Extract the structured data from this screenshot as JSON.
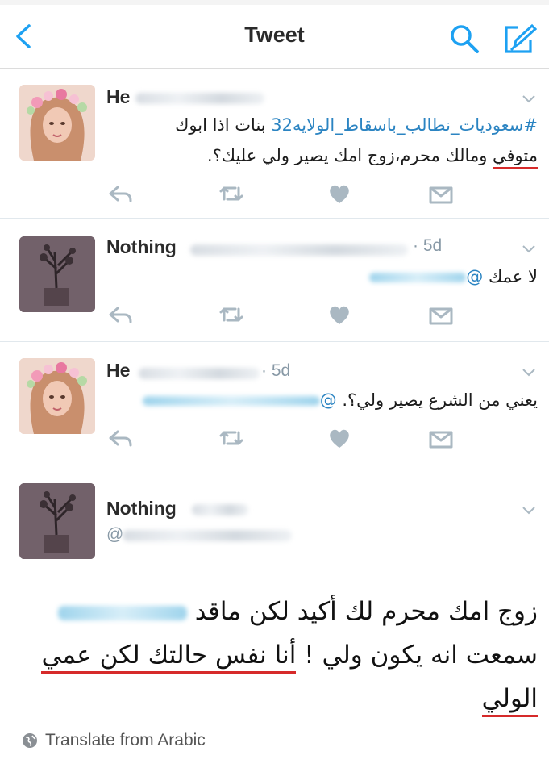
{
  "header": {
    "title": "Tweet"
  },
  "tweets": [
    {
      "name": "He",
      "hashtag": "#سعوديات_نطالب_باسقاط_الولايه32",
      "line1_rest": " بنات اذا ابوك",
      "line2_u": "متوفي",
      "line2_rest": " ومالك محرم،زوج امك يصير ولي عليك؟."
    },
    {
      "name": "Nothing",
      "time": "· 5d",
      "at": "@",
      "body": "لا عمك"
    },
    {
      "name": "He",
      "time": "· 5d",
      "at": "@",
      "body": "يعني من الشرع يصير ولي؟."
    },
    {
      "name": "Nothing",
      "handle_at": "@",
      "line1": "زوج امك محرم لك أكيد لكن ماقد",
      "line2_a": "سمعت انه يكون ولي ! ",
      "line2_b": "أنا نفس حالتك",
      "line2_c": " لكن عمي",
      "line3": "الولي"
    }
  ],
  "footer": {
    "translate": "Translate from Arabic"
  }
}
